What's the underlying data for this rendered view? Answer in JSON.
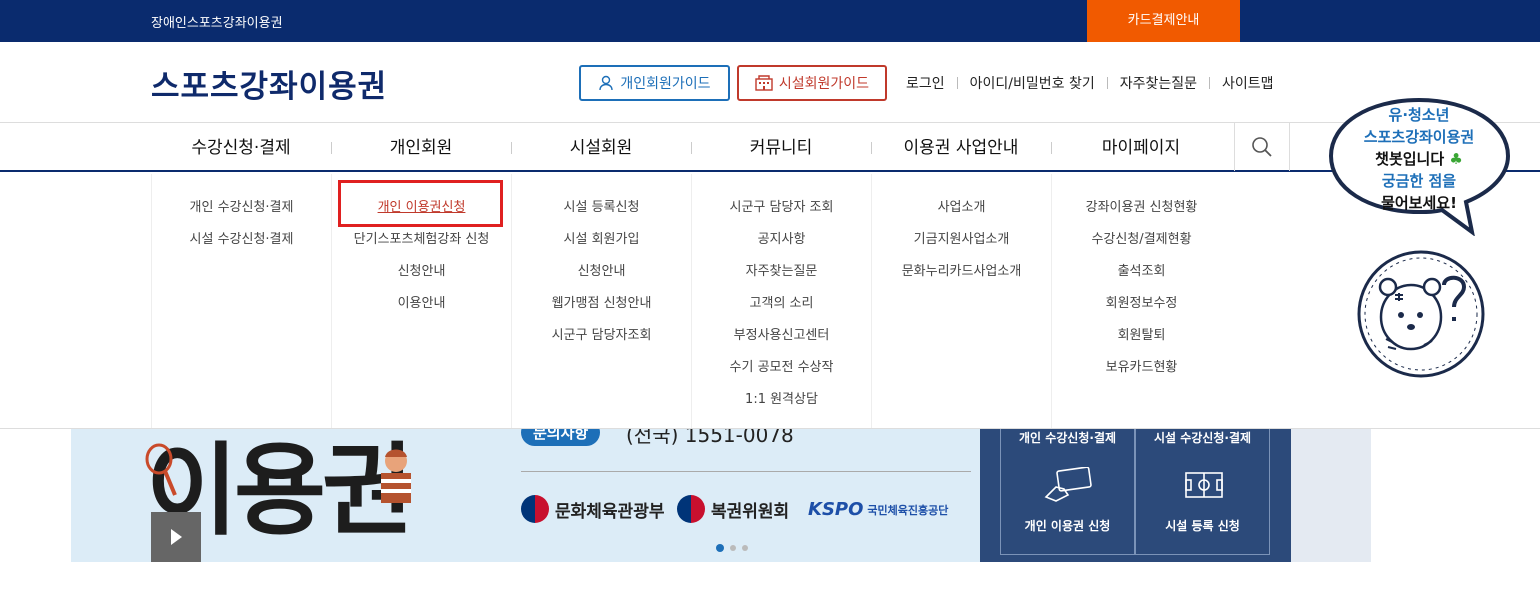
{
  "topbar": {
    "site_name": "장애인스포츠강좌이용권",
    "card_button": "카드결제안내"
  },
  "header": {
    "logo": "스포츠강좌이용권",
    "personal_guide": "개인회원가이드",
    "facility_guide": "시설회원가이드",
    "util_links": [
      "로그인",
      "아이디/비밀번호 찾기",
      "자주찾는질문",
      "사이트맵"
    ]
  },
  "nav": {
    "items": [
      "수강신청·결제",
      "개인회원",
      "시설회원",
      "커뮤니티",
      "이용권 사업안내",
      "마이페이지"
    ]
  },
  "mega": {
    "col1": [
      "개인 수강신청·결제",
      "시설 수강신청·결제"
    ],
    "col2": [
      "개인 이용권신청",
      "단기스포츠체험강좌 신청",
      "신청안내",
      "이용안내"
    ],
    "col3": [
      "시설 등록신청",
      "시설 회원가입",
      "신청안내",
      "웹가맹점 신청안내",
      "시군구 담당자조회"
    ],
    "col4": [
      "시군구 담당자 조회",
      "공지사항",
      "자주찾는질문",
      "고객의 소리",
      "부정사용신고센터",
      "수기 공모전 수상작",
      "1:1 원격상담"
    ],
    "col5": [
      "사업소개",
      "기금지원사업소개",
      "문화누리카드사업소개"
    ],
    "col6": [
      "강좌이용권 신청현황",
      "수강신청/결제현황",
      "출석조회",
      "회원정보수정",
      "회원탈퇴",
      "보유카드현황"
    ]
  },
  "banner": {
    "big_text": "이용권",
    "phone_label": "문의사항",
    "phone": "(전국) 1551-0078",
    "orgs": [
      "문화체육관광부",
      "복권위원회"
    ],
    "kspo": "KSPO",
    "kspo_name": "국민체육진흥공단"
  },
  "quick": {
    "personal_title": "개인 수강신청·결제",
    "facility_title": "시설 수강신청·결제",
    "personal_label": "개인 이용권 신청",
    "facility_label": "시설 등록 신청"
  },
  "chatbot": {
    "line1": "유·청소년",
    "line2": "스포츠강좌이용권",
    "line3": "챗봇입니다",
    "line4": "궁금한 점을",
    "line5": "물어보세요!"
  },
  "colors": {
    "navy": "#0a2b6e",
    "orange": "#f15a00",
    "blue": "#1d6fb8",
    "red": "#c0392b"
  }
}
